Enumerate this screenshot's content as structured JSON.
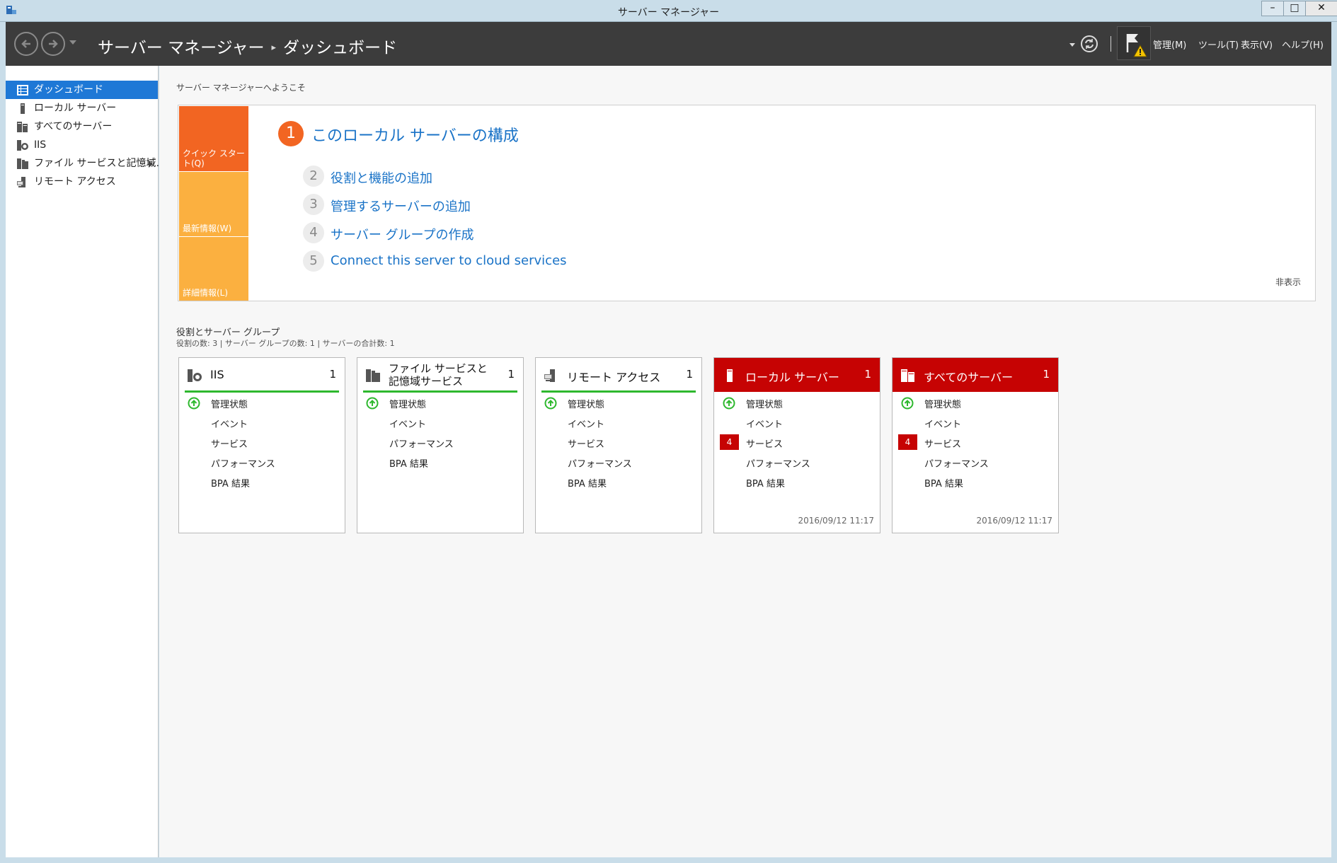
{
  "window": {
    "title": "サーバー マネージャー",
    "minimize_glyph": "–",
    "maximize_glyph": "□",
    "close_glyph": "✕"
  },
  "header": {
    "breadcrumb_root": "サーバー マネージャー",
    "breadcrumb_separator": "▸",
    "breadcrumb_current": "ダッシュボード",
    "menus": [
      "管理(M)",
      "ツール(T)",
      "表示(V)",
      "ヘルプ(H)"
    ]
  },
  "sidebar": {
    "items": [
      {
        "label": "ダッシュボード",
        "icon": "dashboard-icon",
        "active": true
      },
      {
        "label": "ローカル サーバー",
        "icon": "server-icon"
      },
      {
        "label": "すべてのサーバー",
        "icon": "servers-icon"
      },
      {
        "label": "IIS",
        "icon": "iis-icon"
      },
      {
        "label": "ファイル サービスと記憶域…",
        "icon": "file-services-icon",
        "has_submenu": true
      },
      {
        "label": "リモート アクセス",
        "icon": "remote-access-icon"
      }
    ]
  },
  "welcome": {
    "heading": "サーバー マネージャーへようこそ",
    "tabs": [
      "クイック スタート(Q)",
      "最新情報(W)",
      "詳細情報(L)"
    ],
    "primary_step": {
      "number": "1",
      "label": "このローカル サーバーの構成"
    },
    "steps": [
      {
        "number": "2",
        "label": "役割と機能の追加"
      },
      {
        "number": "3",
        "label": "管理するサーバーの追加"
      },
      {
        "number": "4",
        "label": "サーバー グループの作成"
      },
      {
        "number": "5",
        "label": "Connect this server to cloud services"
      }
    ],
    "hide_label": "非表示"
  },
  "roles": {
    "title": "役割とサーバー グループ",
    "subtitle": "役割の数: 3 | サーバー グループの数: 1 | サーバーの合計数: 1",
    "tiles": [
      {
        "title": "IIS",
        "count": "1",
        "icon": "iis-icon",
        "alert": false,
        "rows": [
          {
            "label": "管理状態",
            "status": "ok"
          },
          {
            "label": "イベント"
          },
          {
            "label": "サービス"
          },
          {
            "label": "パフォーマンス"
          },
          {
            "label": "BPA 結果"
          }
        ]
      },
      {
        "title": "ファイル サービスと記憶域サービス",
        "count": "1",
        "icon": "file-services-icon",
        "alert": false,
        "two_line": true,
        "rows": [
          {
            "label": "管理状態",
            "status": "ok"
          },
          {
            "label": "イベント"
          },
          {
            "label": "パフォーマンス"
          },
          {
            "label": "BPA 結果"
          }
        ]
      },
      {
        "title": "リモート アクセス",
        "count": "1",
        "icon": "remote-access-icon",
        "alert": false,
        "rows": [
          {
            "label": "管理状態",
            "status": "ok"
          },
          {
            "label": "イベント"
          },
          {
            "label": "サービス"
          },
          {
            "label": "パフォーマンス"
          },
          {
            "label": "BPA 結果"
          }
        ]
      },
      {
        "title": "ローカル サーバー",
        "count": "1",
        "icon": "server-icon",
        "alert": true,
        "timestamp": "2016/09/12 11:17",
        "rows": [
          {
            "label": "管理状態",
            "status": "ok"
          },
          {
            "label": "イベント"
          },
          {
            "label": "サービス",
            "badge": "4"
          },
          {
            "label": "パフォーマンス"
          },
          {
            "label": "BPA 結果"
          }
        ]
      },
      {
        "title": "すべてのサーバー",
        "count": "1",
        "icon": "servers-icon",
        "alert": true,
        "timestamp": "2016/09/12 11:17",
        "rows": [
          {
            "label": "管理状態",
            "status": "ok"
          },
          {
            "label": "イベント"
          },
          {
            "label": "サービス",
            "badge": "4"
          },
          {
            "label": "パフォーマンス"
          },
          {
            "label": "BPA 結果"
          }
        ]
      }
    ]
  },
  "colors": {
    "accent": "#1e78d6",
    "alert": "#c60303",
    "ok": "#2eb82e",
    "quickstart": "#f26522",
    "tab": "#fbb040",
    "link": "#1a73c7"
  }
}
